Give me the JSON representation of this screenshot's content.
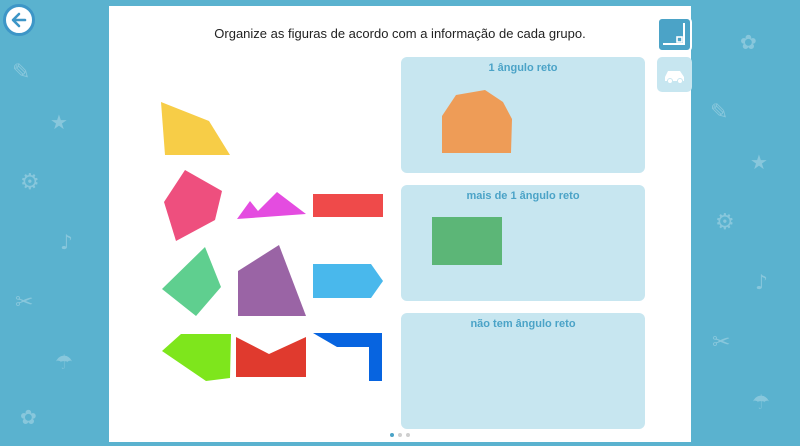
{
  "instruction": "Organize as figuras de acordo com a informação de cada grupo.",
  "groups": [
    {
      "label": "1 ângulo reto"
    },
    {
      "label": "mais de 1 ângulo reto"
    },
    {
      "label": "não tem ângulo reto"
    }
  ],
  "icons": {
    "back": "back-arrow-icon",
    "right_angle_tool": "right-angle-icon",
    "car": "car-icon"
  },
  "colors": {
    "background": "#5ab2cf",
    "group_box": "#c7e6f0",
    "group_label": "#4ba3c7",
    "accent": "#3d96c7"
  },
  "pager": {
    "pages": 3,
    "current": 1
  }
}
